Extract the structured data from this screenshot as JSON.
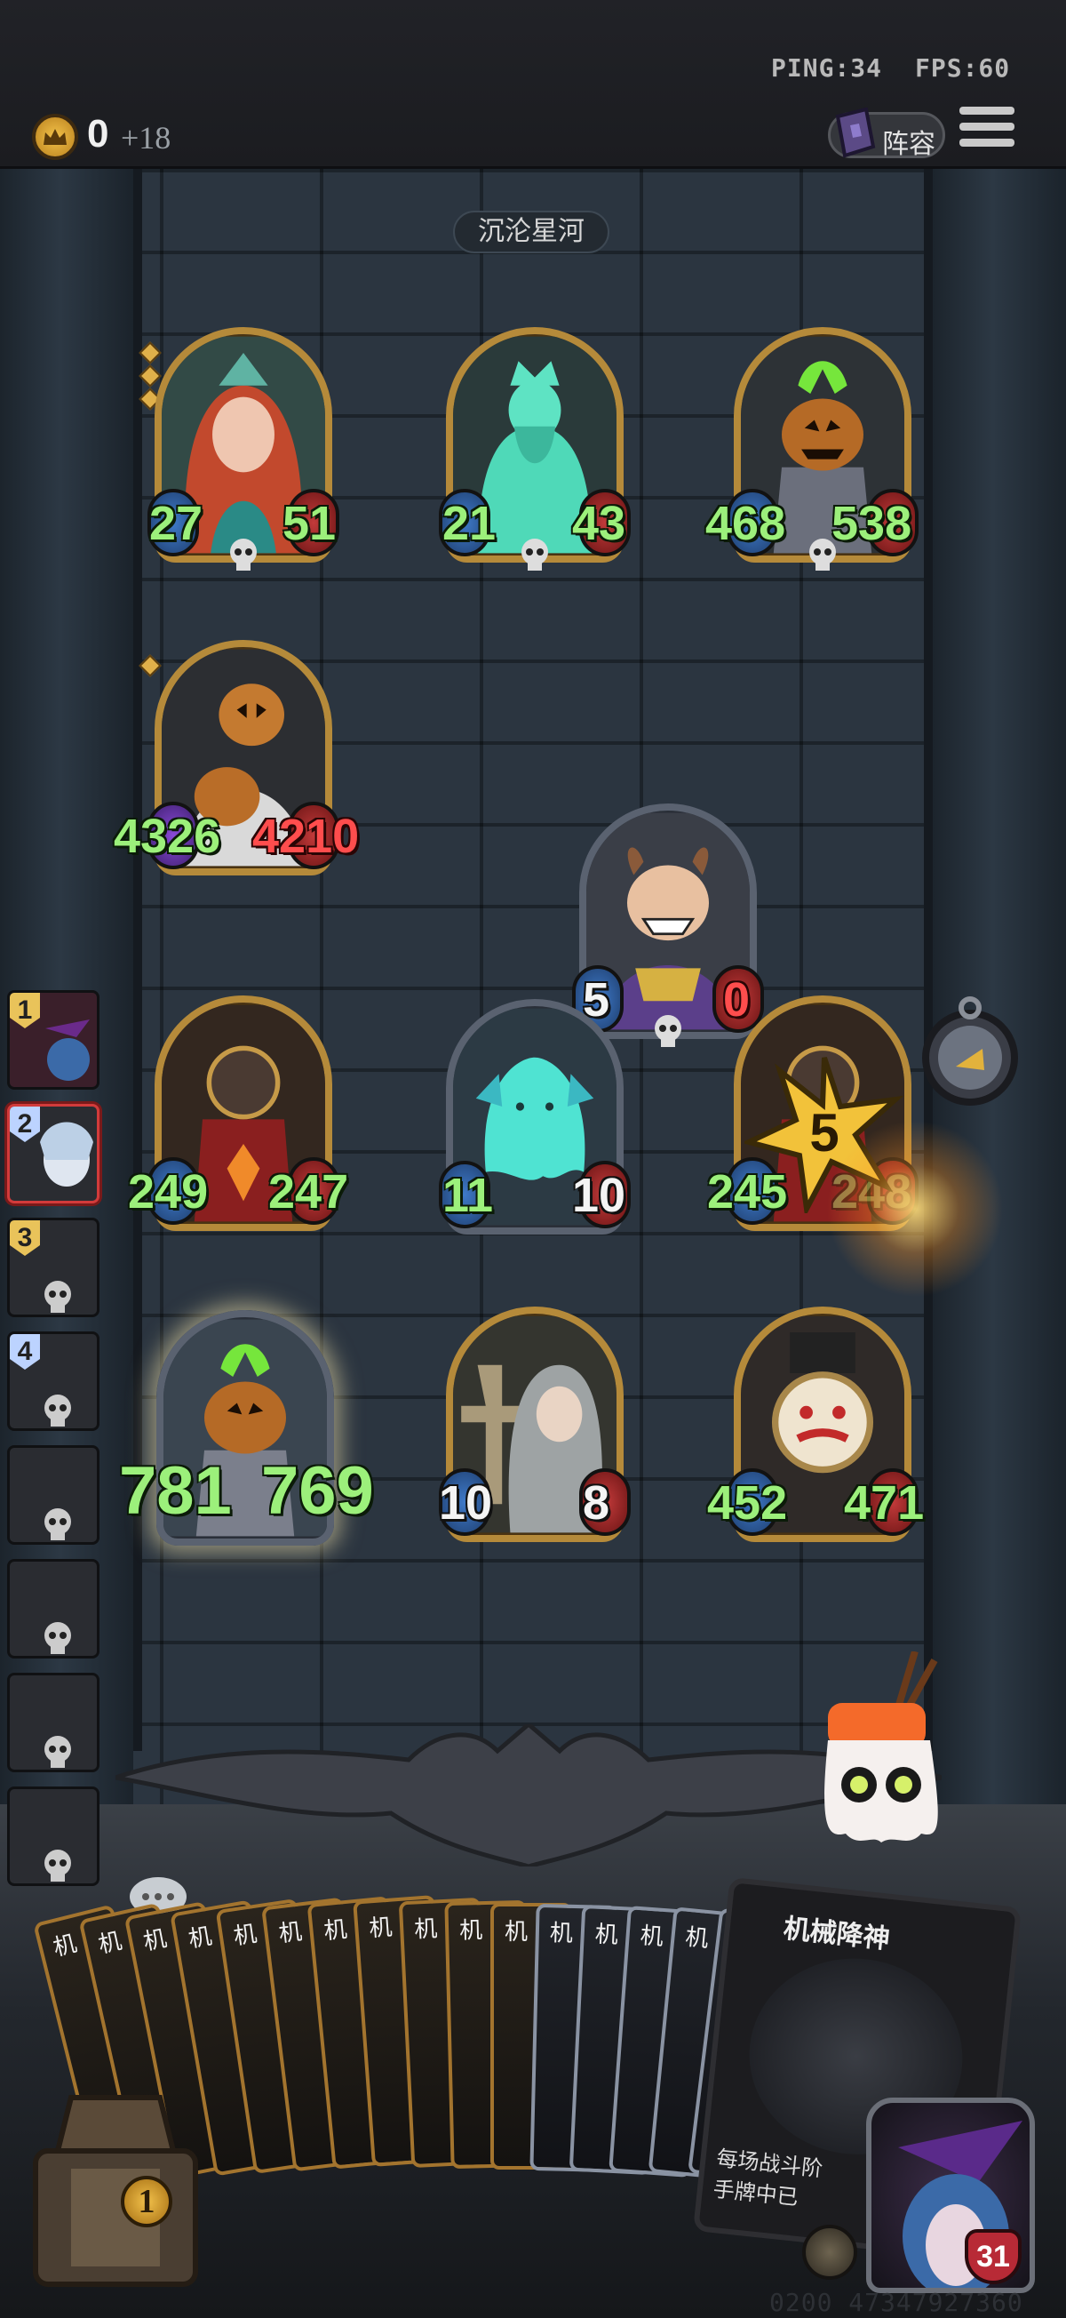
{
  "hud": {
    "ping": "PING:34",
    "fps": "FPS:60",
    "gold": "0",
    "gold_income": "+18",
    "lineup_label": "阵容"
  },
  "map_name": "沉沦星河",
  "board": {
    "enemy_row1": [
      {
        "attack": "27",
        "health": "51"
      },
      {
        "attack": "21",
        "health": "43"
      },
      {
        "attack": "468",
        "health": "538"
      }
    ],
    "enemy_row2": [
      {
        "attack": "4326",
        "health": "4210"
      }
    ],
    "center_minion": {
      "attack": "5",
      "health": "0"
    },
    "friendly_row1": [
      {
        "attack": "249",
        "health": "247"
      },
      {
        "attack": "11",
        "health": "10"
      },
      {
        "attack": "245",
        "health": "248",
        "star_value": "5"
      }
    ],
    "friendly_row2": [
      {
        "attack": "781",
        "health": "769"
      },
      {
        "attack": "10",
        "health": "8"
      },
      {
        "attack": "452",
        "health": "471"
      }
    ]
  },
  "side_ranks": [
    "1",
    "2",
    "3",
    "4"
  ],
  "hand": {
    "card_label": "机",
    "card_count": 16,
    "featured_card_title": "机械降神",
    "featured_card_text": "每场战斗阶\n手牌中已"
  },
  "chest_count": "1",
  "hero_health": "31",
  "game_id": "0200 47347927360",
  "colors": {
    "stat_green": "#9cf07b",
    "stat_red": "#ff4d4d",
    "gold_frame": "#b58a3a",
    "silver_frame": "#5a6270",
    "wall": "#2b3540"
  }
}
